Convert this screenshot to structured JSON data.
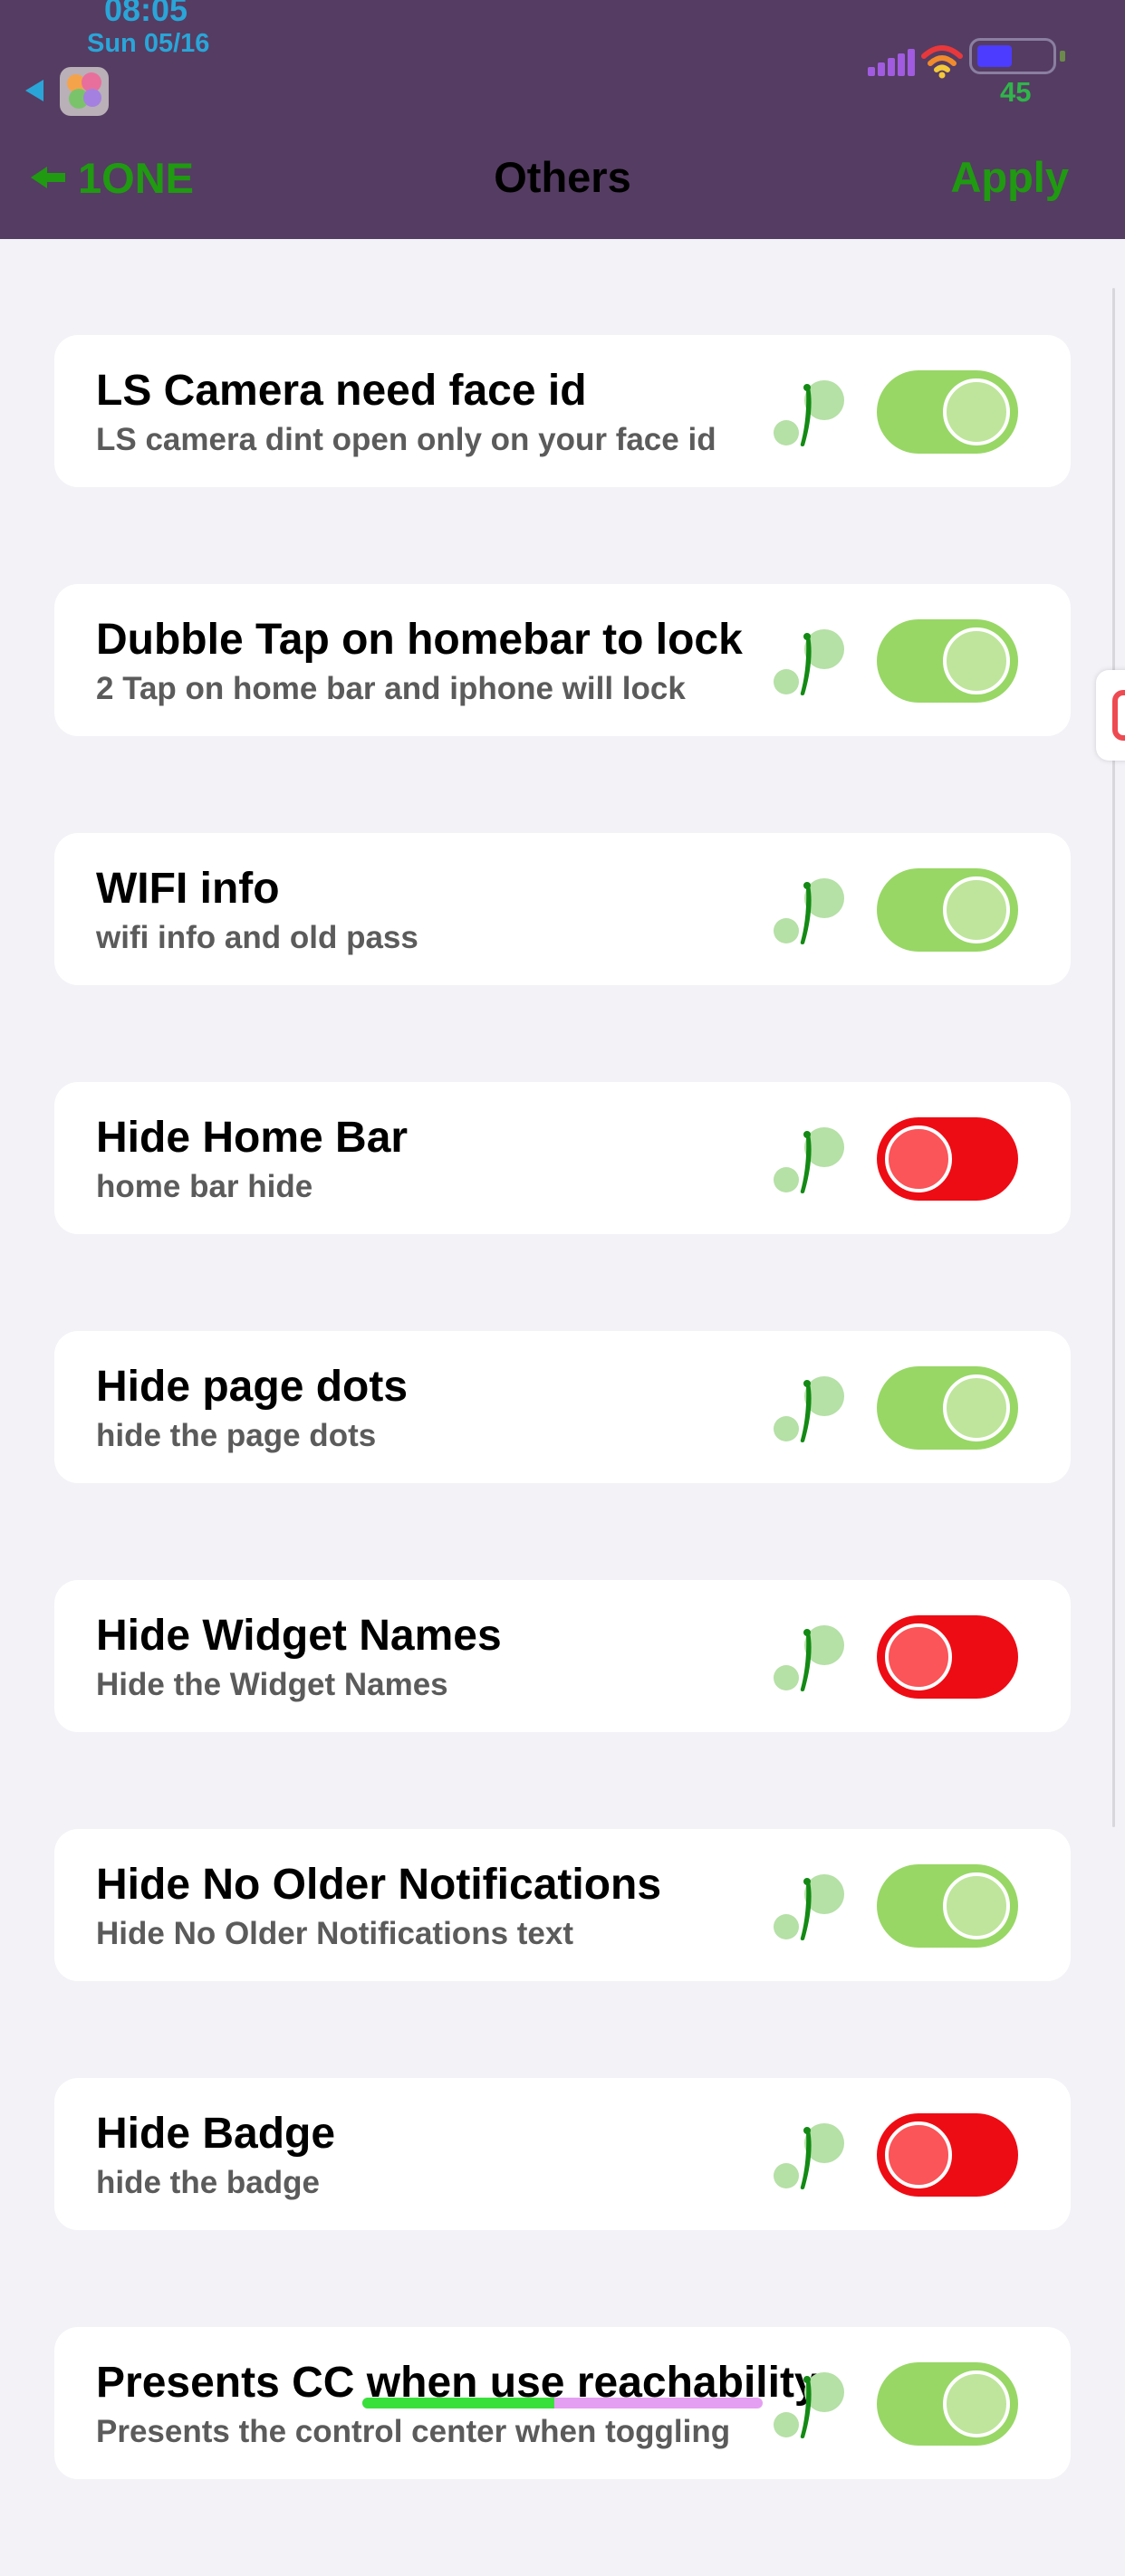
{
  "status_bar": {
    "time": "08:05",
    "date": "Sun 05/16",
    "battery_level": "45"
  },
  "nav": {
    "back_label": "1ONE",
    "title": "Others",
    "apply_label": "Apply"
  },
  "settings": [
    {
      "title": "LS Camera need face id",
      "subtitle": "LS camera dint open only on your face id",
      "enabled": true
    },
    {
      "title": "Dubble Tap on homebar to lock",
      "subtitle": "2 Tap on home bar and iphone will lock",
      "enabled": true
    },
    {
      "title": "WIFI info",
      "subtitle": "wifi info and old pass",
      "enabled": true
    },
    {
      "title": "Hide Home Bar",
      "subtitle": "home bar hide",
      "enabled": false
    },
    {
      "title": "Hide page dots",
      "subtitle": "hide the page dots",
      "enabled": true
    },
    {
      "title": "Hide Widget Names",
      "subtitle": "Hide the Widget Names",
      "enabled": false
    },
    {
      "title": "Hide No Older Notifications",
      "subtitle": "Hide No Older Notifications text",
      "enabled": true
    },
    {
      "title": "Hide Badge",
      "subtitle": "hide the badge",
      "enabled": false
    },
    {
      "title": "Presents CC when use reachability",
      "subtitle": "Presents the control center when toggling",
      "enabled": true
    }
  ],
  "home_indicator": {
    "progress": 0.48
  },
  "colors": {
    "header_bg": "#553c62",
    "accent_green": "#1f9a11",
    "toggle_on": "#98d766",
    "toggle_off": "#ee0c14"
  }
}
